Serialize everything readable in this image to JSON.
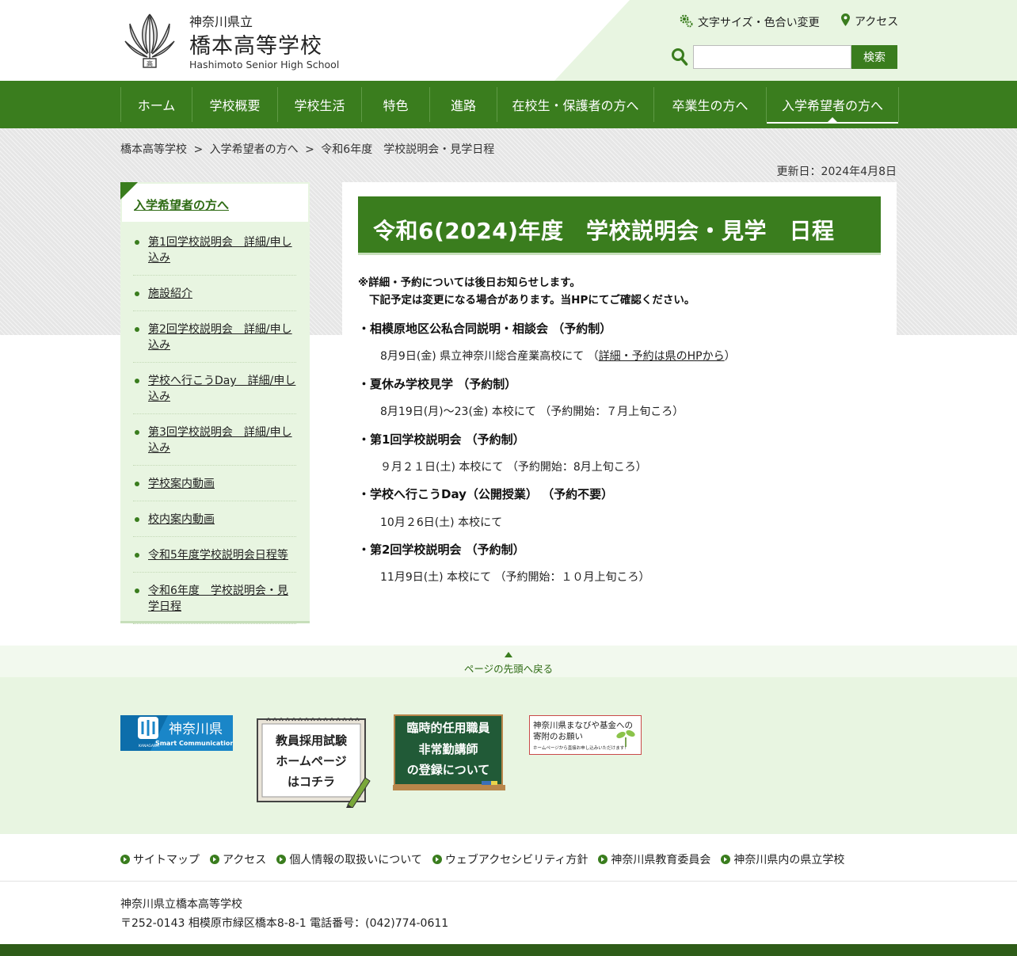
{
  "header": {
    "prefecture": "神奈川県立",
    "school_name": "橋本高等学校",
    "school_name_en": "Hashimoto Senior High School",
    "text_size_link": "文字サイズ・色合い変更",
    "access_link": "アクセス",
    "search_placeholder": "",
    "search_button": "検索"
  },
  "nav": {
    "items": [
      "ホーム",
      "学校概要",
      "学校生活",
      "特色",
      "進路",
      "在校生・保護者の方へ",
      "卒業生の方へ",
      "入学希望者の方へ"
    ],
    "active": "入学希望者の方へ"
  },
  "breadcrumb": [
    "橋本高等学校",
    "入学希望者の方へ",
    "令和6年度　学校説明会・見学日程"
  ],
  "breadcrumb_sep": ">",
  "updated": "更新日：2024年4月8日",
  "sidebar": {
    "heading": "入学希望者の方へ",
    "items": [
      "第1回学校説明会　詳細/申し込み",
      "施設紹介",
      "第2回学校説明会　詳細/申し込み",
      "学校へ行こうDay　詳細/申し込み",
      "第3回学校説明会　詳細/申し込み",
      "学校案内動画",
      "校内案内動画",
      "令和5年度学校説明会日程等",
      "令和6年度　学校説明会・見学日程"
    ]
  },
  "main": {
    "title": "令和6(2024)年度　学校説明会・見学　日程",
    "notice_line1": "※詳細・予約については後日お知らせします。",
    "notice_line2": "下記予定は変更になる場合があります。当HPにてご確認ください。",
    "events": [
      {
        "title": "・相模原地区公私合同説明・相談会 （予約制）",
        "detail": "8月9日(金) 県立神奈川総合産業高校にて （",
        "link": "詳細・予約は県のHPから",
        "detail_end": "）"
      },
      {
        "title": "・夏休み学校見学 （予約制）",
        "detail": "8月19日(月)～23(金) 本校にて （予約開始：７月上旬ころ）"
      },
      {
        "title": "・第1回学校説明会 （予約制）",
        "detail": "９月２１日(土) 本校にて （予約開始：8月上旬ころ）"
      },
      {
        "title": "・学校へ行こうDay（公開授業） （予約不要）",
        "detail": "10月２6日(土) 本校にて"
      },
      {
        "title": "・第2回学校説明会 （予約制）",
        "detail": "11月9日(土) 本校にて （予約開始：１０月上旬ころ）"
      }
    ]
  },
  "pagetop": "ページの先頭へ戻る",
  "banners": {
    "kanagawa": {
      "title": "神奈川県",
      "sub": "Smart Communication",
      "small": "KANAGAWA"
    },
    "teacher": {
      "line1": "教員採用試験",
      "line2": "ホームページ",
      "line3": "はコチラ"
    },
    "temporary": {
      "line1": "臨時的任用職員",
      "line2": "非常勤講師",
      "line3": "の登録について"
    },
    "fund": {
      "line1": "神奈川県まなびや基金への",
      "line2": "寄附のお願い",
      "line3": "ホームページから直接お申し込みいただけます！"
    }
  },
  "footer_links": [
    "サイトマップ",
    "アクセス",
    "個人情報の取扱いについて",
    "ウェブアクセシビリティ方針",
    "神奈川県教育委員会",
    "神奈川県内の県立学校"
  ],
  "address": {
    "name": "神奈川県立橋本高等学校",
    "detail": "〒252-0143 相模原市緑区橋本8-8-1 電話番号：(042)774-0611"
  },
  "colors": {
    "brand_green": "#3a7d1e",
    "light_green": "#e8f5e1"
  }
}
